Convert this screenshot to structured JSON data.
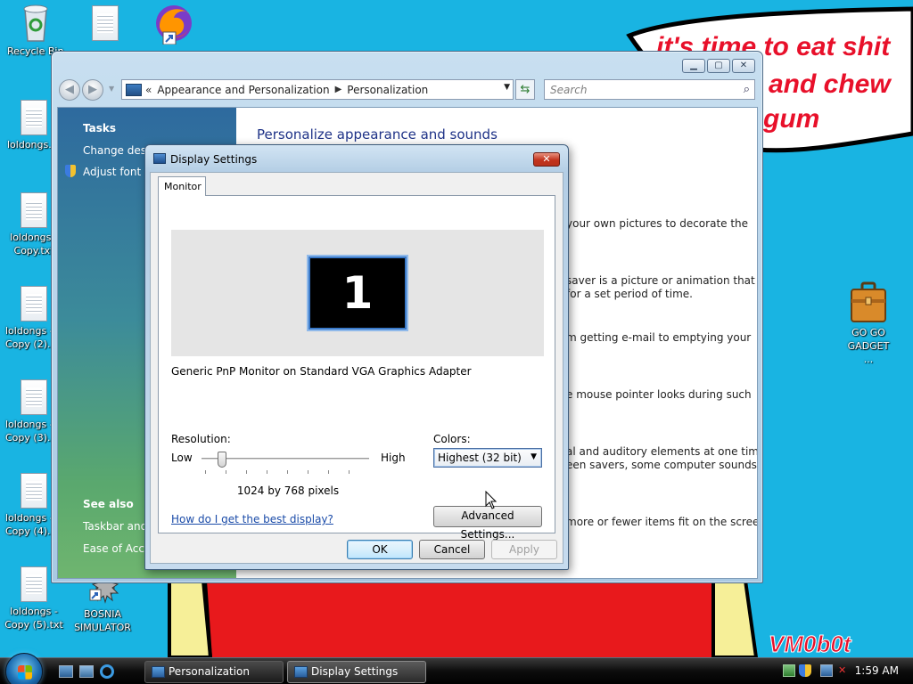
{
  "desktop": {
    "banner_text": "it's time to eat shit and chew gum",
    "banner_lines": [
      "it's time to eat shit",
      "and chew",
      "gum"
    ],
    "signature": "VM0b0t",
    "colors": {
      "background": "#19b4e2",
      "banner_text": "#e8102a",
      "signature": "#e8102a"
    },
    "icons": [
      {
        "label": "Recycle Bin",
        "icon": "recycle-bin-icon"
      },
      {
        "label": "",
        "icon": "text-file-icon"
      },
      {
        "label": "",
        "icon": "firefox-icon"
      },
      {
        "label": "loldongs.",
        "icon": "text-file-icon"
      },
      {
        "label": "loldongs - Copy.txt",
        "icon": "text-file-icon"
      },
      {
        "label": "loldongs - Copy (2).",
        "icon": "text-file-icon"
      },
      {
        "label": "loldongs - Copy (3).",
        "icon": "text-file-icon"
      },
      {
        "label": "loldongs - Copy (4).",
        "icon": "text-file-icon"
      },
      {
        "label": "loldongs - Copy (5).txt",
        "icon": "text-file-icon"
      },
      {
        "label": "BOSNIA SIMULATOR",
        "icon": "bosnia-simulator-icon"
      },
      {
        "label": "GO GO GADGET ...",
        "icon": "briefcase-icon"
      }
    ]
  },
  "personalization_window": {
    "breadcrumb": [
      "Appearance and Personalization",
      "Personalization"
    ],
    "breadcrumb_prefix": "«",
    "search_placeholder": "Search",
    "tasks_heading": "Tasks",
    "tasks": [
      "Change desk",
      "Adjust font si"
    ],
    "see_also_heading": "See also",
    "see_also": [
      "Taskbar and S",
      "Ease of Acces"
    ],
    "main_title": "Personalize appearance and sounds",
    "descriptions": [
      "your own pictures to decorate the",
      "saver is a picture or animation that",
      "for a set period of time.",
      "m getting e-mail to emptying your",
      "e mouse pointer looks during such",
      "al and auditory elements at one time",
      "een savers, some computer sounds,",
      "more or fewer items fit on the screen."
    ]
  },
  "display_settings": {
    "title": "Display Settings",
    "tab": "Monitor",
    "monitor_number": "1",
    "monitor_description": "Generic PnP Monitor on Standard VGA Graphics Adapter",
    "resolution_label": "Resolution:",
    "low_label": "Low",
    "high_label": "High",
    "resolution_value": "1024 by 768 pixels",
    "resolution_slider_fraction": 0.1,
    "colors_label": "Colors:",
    "colors_value": "Highest (32 bit)",
    "help_link": "How do I get the best display?",
    "advanced_button": "Advanced Settings...",
    "ok_button": "OK",
    "cancel_button": "Cancel",
    "apply_button": "Apply"
  },
  "taskbar": {
    "buttons": [
      "Personalization",
      "Display Settings"
    ],
    "clock": "1:59 AM"
  }
}
